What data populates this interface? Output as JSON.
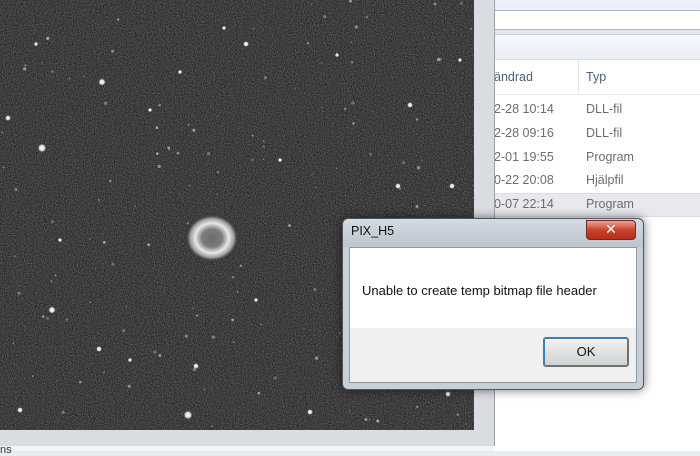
{
  "explorer": {
    "columns": {
      "date": "ändrad",
      "type": "Typ"
    },
    "rows": [
      {
        "date": "2-28 10:14",
        "type": "DLL-fil",
        "selected": false
      },
      {
        "date": "2-28 09:16",
        "type": "DLL-fil",
        "selected": false
      },
      {
        "date": "2-01 19:55",
        "type": "Program",
        "selected": false
      },
      {
        "date": "0-22 20:08",
        "type": "Hjälpfil",
        "selected": false
      },
      {
        "date": "0-07 22:14",
        "type": "Program",
        "selected": true
      }
    ]
  },
  "viewer": {
    "image_description_icon": "ring-nebula-image",
    "bottom_text": "ns"
  },
  "dialog": {
    "title": "PIX_H5",
    "close_icon": "close-icon",
    "message": "Unable to create temp bitmap file header",
    "ok_label": "OK"
  },
  "colors": {
    "dialog_frame": "#c9cfd6",
    "close_button": "#c8432c",
    "ok_focus_ring": "#3c7fb1",
    "image_background": "#111111"
  }
}
